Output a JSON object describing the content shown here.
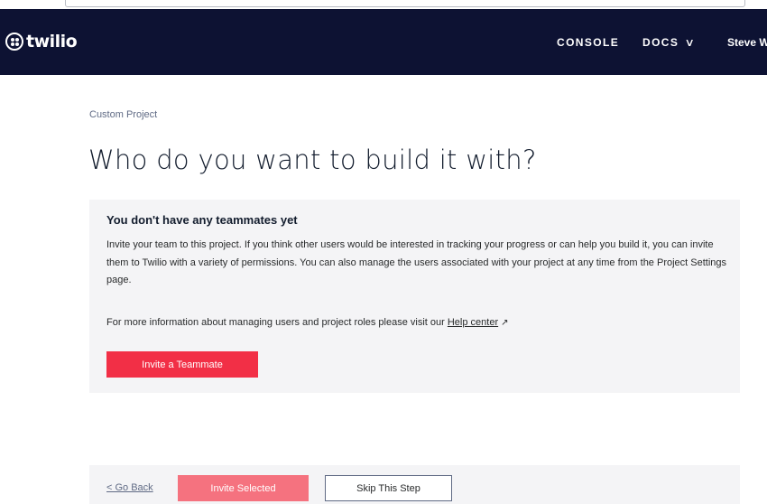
{
  "nav": {
    "logo_text": "twilio",
    "console": "CONSOLE",
    "docs": "DOCS",
    "docs_chevron": "∨",
    "user": "Steve W"
  },
  "breadcrumb": "Custom Project",
  "page_title": "Who do you want to build it with?",
  "card": {
    "heading": "You don't have any teammates yet",
    "body": "Invite your team to this project. If you think other users would be interested in tracking your progress or can help you build it, you can invite them to Twilio with a variety of permissions. You can also manage the users associated with your project at any time from the Project Settings page.",
    "more_text": "For more information about managing users and project roles please visit our ",
    "help_link": "Help center",
    "ext_icon": "↗",
    "invite_button": "Invite a Teammate"
  },
  "footer": {
    "go_back": "< Go Back",
    "invite_selected": "Invite Selected",
    "skip": "Skip This Step"
  },
  "colors": {
    "nav_bg": "#0d1233",
    "brand_red": "#f22f46",
    "brand_red_disabled": "#f5727f",
    "card_bg": "#f4f4f6"
  }
}
